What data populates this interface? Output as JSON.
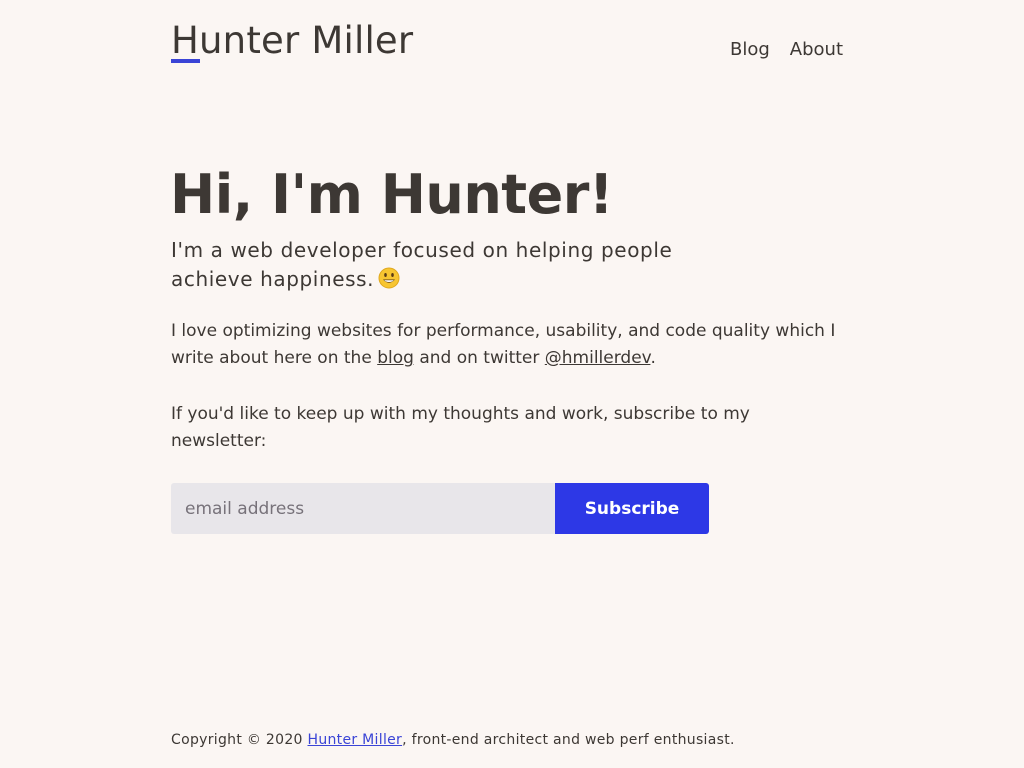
{
  "header": {
    "site_title": "Hunter Miller",
    "nav": [
      {
        "label": "Blog"
      },
      {
        "label": "About"
      }
    ]
  },
  "hero": {
    "title": "Hi, I'm Hunter!",
    "tagline": "I'm a web developer focused on helping people achieve happiness.",
    "emoji_icon": "grinning-face-icon"
  },
  "intro": {
    "text_before": "I love optimizing websites for performance, usability, and code quality which I write about here on the ",
    "blog_link": "blog",
    "text_middle": " and on twitter ",
    "twitter_link": "@hmillerdev",
    "text_after": "."
  },
  "newsletter": {
    "text": "If you'd like to keep up with my thoughts and work, subscribe to my newsletter:",
    "email_placeholder": "email address",
    "email_value": "",
    "button_label": "Subscribe"
  },
  "footer": {
    "prefix": "Copyright © 2020 ",
    "name_link": "Hunter Miller",
    "suffix": ", front-end architect and web perf enthusiast."
  },
  "colors": {
    "background": "#fbf6f3",
    "text": "#3d3834",
    "accent": "#2d38e6",
    "input_background": "#e8e6ea"
  }
}
